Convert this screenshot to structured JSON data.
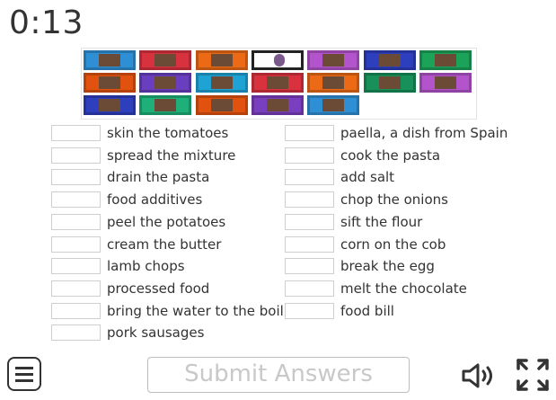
{
  "timer": "0:13",
  "tiles": [
    {
      "color": "#2f8fd4"
    },
    {
      "color": "#d8323f"
    },
    {
      "color": "#ec6a16"
    },
    {
      "color": "#ffffff",
      "selected": true
    },
    {
      "color": "#b354cc"
    },
    {
      "color": "#2d3fbd"
    },
    {
      "color": "#1ca35a"
    },
    {
      "color": "#e2520f"
    },
    {
      "color": "#6a3fbf"
    },
    {
      "color": "#1fa2d4"
    },
    {
      "color": "#d8323f"
    },
    {
      "color": "#ec6a16"
    },
    {
      "color": "#18905a"
    },
    {
      "color": "#b354cc"
    },
    {
      "color": "#2d3fbd"
    },
    {
      "color": "#1fb07a"
    },
    {
      "color": "#e2520f"
    },
    {
      "color": "#7a3fbf"
    },
    {
      "color": "#2f8fd4"
    }
  ],
  "left_items": [
    "skin the tomatoes",
    "spread the mixture",
    "drain the pasta",
    "food additives",
    "peel the potatoes",
    "cream the butter",
    "lamb chops",
    "processed food",
    "bring the water to the boil",
    "pork sausages"
  ],
  "right_items": [
    "paella, a dish from Spain",
    "cook the pasta",
    "add salt",
    "chop the onions",
    "sift the flour",
    "corn on the cob",
    "break the egg",
    "melt the chocolate",
    "food bill"
  ],
  "submit_label": "Submit Answers",
  "icons": {
    "menu": "menu-icon",
    "sound": "speaker-icon",
    "fullscreen": "fullscreen-icon"
  }
}
